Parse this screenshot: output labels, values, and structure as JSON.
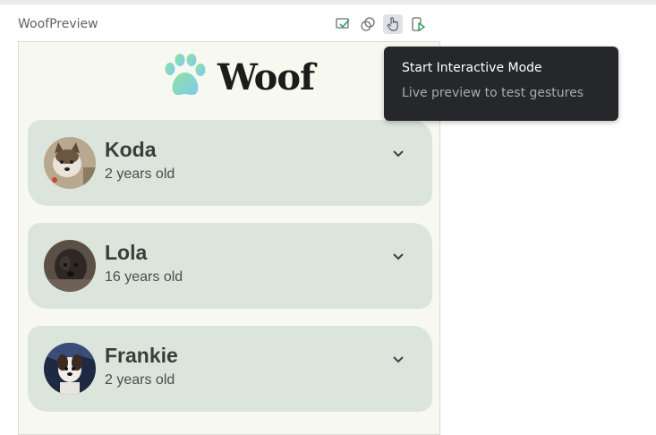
{
  "preview": {
    "title": "WoofPreview"
  },
  "toolbar": {
    "buttons": [
      {
        "icon": "preview-check-icon"
      },
      {
        "icon": "animation-icon"
      },
      {
        "icon": "interactive-mode-icon",
        "active": true
      },
      {
        "icon": "deploy-run-icon"
      }
    ]
  },
  "app": {
    "brand": "Woof",
    "dogs": [
      {
        "name": "Koda",
        "age": "2 years old"
      },
      {
        "name": "Lola",
        "age": "16 years old"
      },
      {
        "name": "Frankie",
        "age": "2 years old"
      }
    ]
  },
  "tooltip": {
    "title": "Start Interactive Mode",
    "subtitle": "Live preview to test gestures"
  },
  "colors": {
    "card": "#dbe5db",
    "surface": "#f7f9f1",
    "tooltip": "#26272b",
    "accent_green": "#2e9e5b"
  }
}
